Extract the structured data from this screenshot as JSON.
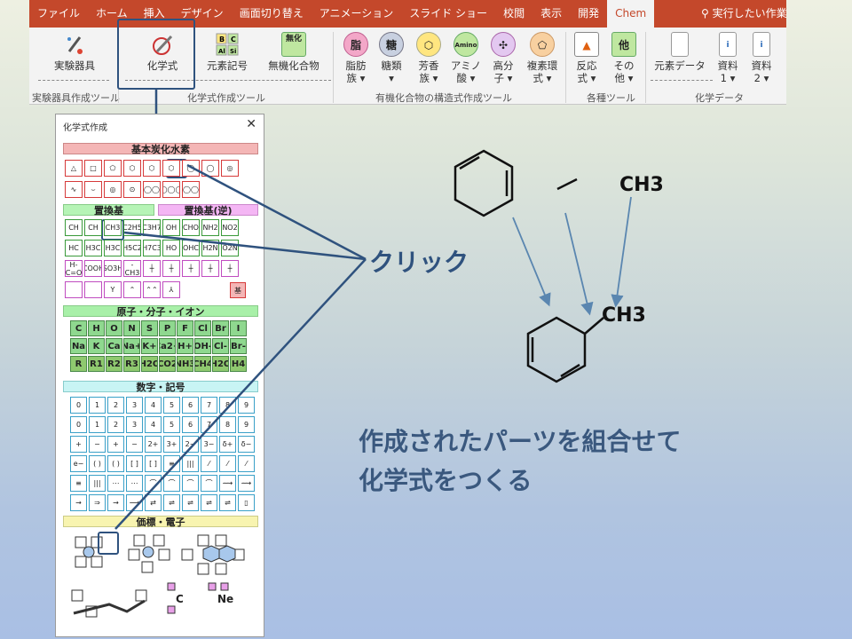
{
  "ribbon": {
    "tabs": [
      "ファイル",
      "ホーム",
      "挿入",
      "デザイン",
      "画面切り替え",
      "アニメーション",
      "スライド ショー",
      "校閲",
      "表示",
      "開発",
      "Chem"
    ],
    "search": "実行したい作業を",
    "buttons": {
      "lab": "実験器具",
      "formula": "化学式",
      "element": "元素記号",
      "inorganic": "無機化合物",
      "aliphatic": "脂肪族",
      "sugar": "糖類",
      "aromatic": "芳香族",
      "amino": "アミノ酸",
      "polymer": "高分子",
      "hetero": "複素環式",
      "reaction": "反応式",
      "other": "その他",
      "edata": "元素データ",
      "doc1": "資料1",
      "doc2": "資料2"
    },
    "icons": {
      "aliphatic": "脂",
      "sugar": "糖",
      "inorganic": "無化"
    },
    "groups": [
      "実験器具作成ツール",
      "化学式作成ツール",
      "有機化合物の構造式作成ツール",
      "各種ツール",
      "化学データ"
    ]
  },
  "palette": {
    "title": "化学式作成",
    "sections": [
      "基本炭化水素",
      "置換基",
      "置換基(逆)",
      "原子・分子・イオン",
      "数字・記号",
      "価標・電子"
    ],
    "substituents": [
      "CH",
      "CH",
      "CH3",
      "C2H5",
      "C3H7",
      "OH",
      "CHO",
      "NH2",
      "NO2",
      "HC",
      "H3C",
      "H3C",
      "H5C2",
      "H7C3",
      "HO",
      "OHC",
      "H2N",
      "O2N",
      "H-C=O",
      "COOH",
      "SO3H",
      "-CH3"
    ],
    "sub_extra": [
      "基"
    ],
    "atoms": [
      "C",
      "H",
      "O",
      "N",
      "S",
      "P",
      "F",
      "Cl",
      "Br",
      "I",
      "Na",
      "K",
      "Ca",
      "Na+",
      "K+",
      "Ca2+",
      "H+",
      "OH-",
      "Cl-",
      "Br-",
      "R",
      "R1",
      "R2",
      "R3",
      "H2O",
      "CO2",
      "NH3",
      "CH4",
      "H2O",
      "NH4+"
    ],
    "digits": [
      "0",
      "1",
      "2",
      "3",
      "4",
      "5",
      "6",
      "7",
      "8",
      "9",
      "0",
      "1",
      "2",
      "3",
      "4",
      "5",
      "6",
      "7",
      "8",
      "9"
    ],
    "symbols": [
      "+",
      "−",
      "+",
      "−",
      "2+",
      "3+",
      "2−",
      "3−",
      "δ+",
      "δ−",
      "e−",
      "( )",
      "( )",
      "[ ]",
      "[ ]",
      "≡",
      "|||"
    ],
    "lewis": [
      "C",
      "Ne"
    ]
  },
  "drawing": {
    "ch3": "CH3",
    "ch3_product": "CH3"
  },
  "callouts": {
    "click": "クリック",
    "combine1": "作成されたパーツを組合せて",
    "combine2": "化学式をつくる"
  }
}
